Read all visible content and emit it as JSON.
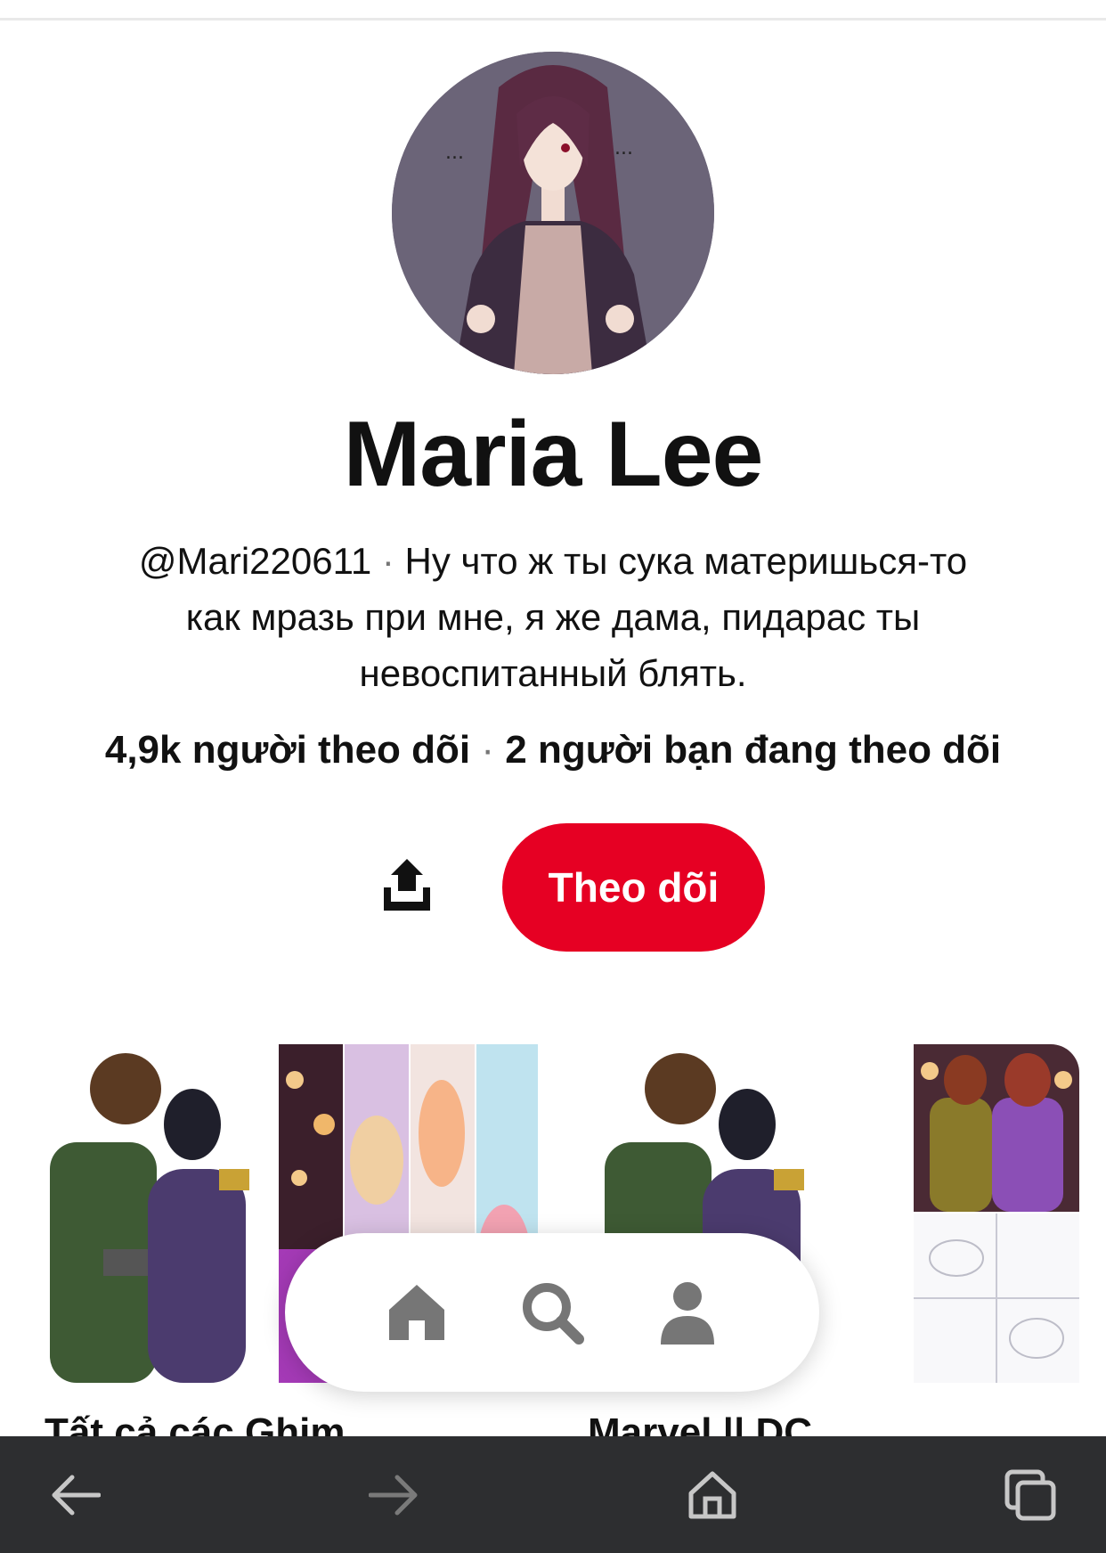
{
  "profile": {
    "name": "Maria Lee",
    "handle": "@Mari220611",
    "bio_separator": "·",
    "bio_line1": " Ну что ж ты сука материшься-то",
    "bio_line2": "как мразь при мне, я же дама, пидарас ты",
    "bio_line3": "невоспитанный блять.",
    "followers": "4,9k người theo dõi",
    "stats_separator": " · ",
    "friends_following": "2 người bạn đang theo dõi"
  },
  "actions": {
    "follow_label": "Theo dõi",
    "share_icon": "share-icon"
  },
  "boards": [
    {
      "title": "Tất cả các Ghim"
    },
    {
      "title": "Marvel || DC"
    }
  ],
  "bottom_nav": {
    "items": [
      "home-icon",
      "search-icon",
      "profile-icon"
    ]
  },
  "browser_bar": {
    "items": [
      "back-arrow-icon",
      "forward-arrow-icon",
      "home-icon",
      "tabs-icon"
    ]
  },
  "colors": {
    "accent": "#e60023",
    "browser_bar": "#2d2e30"
  }
}
